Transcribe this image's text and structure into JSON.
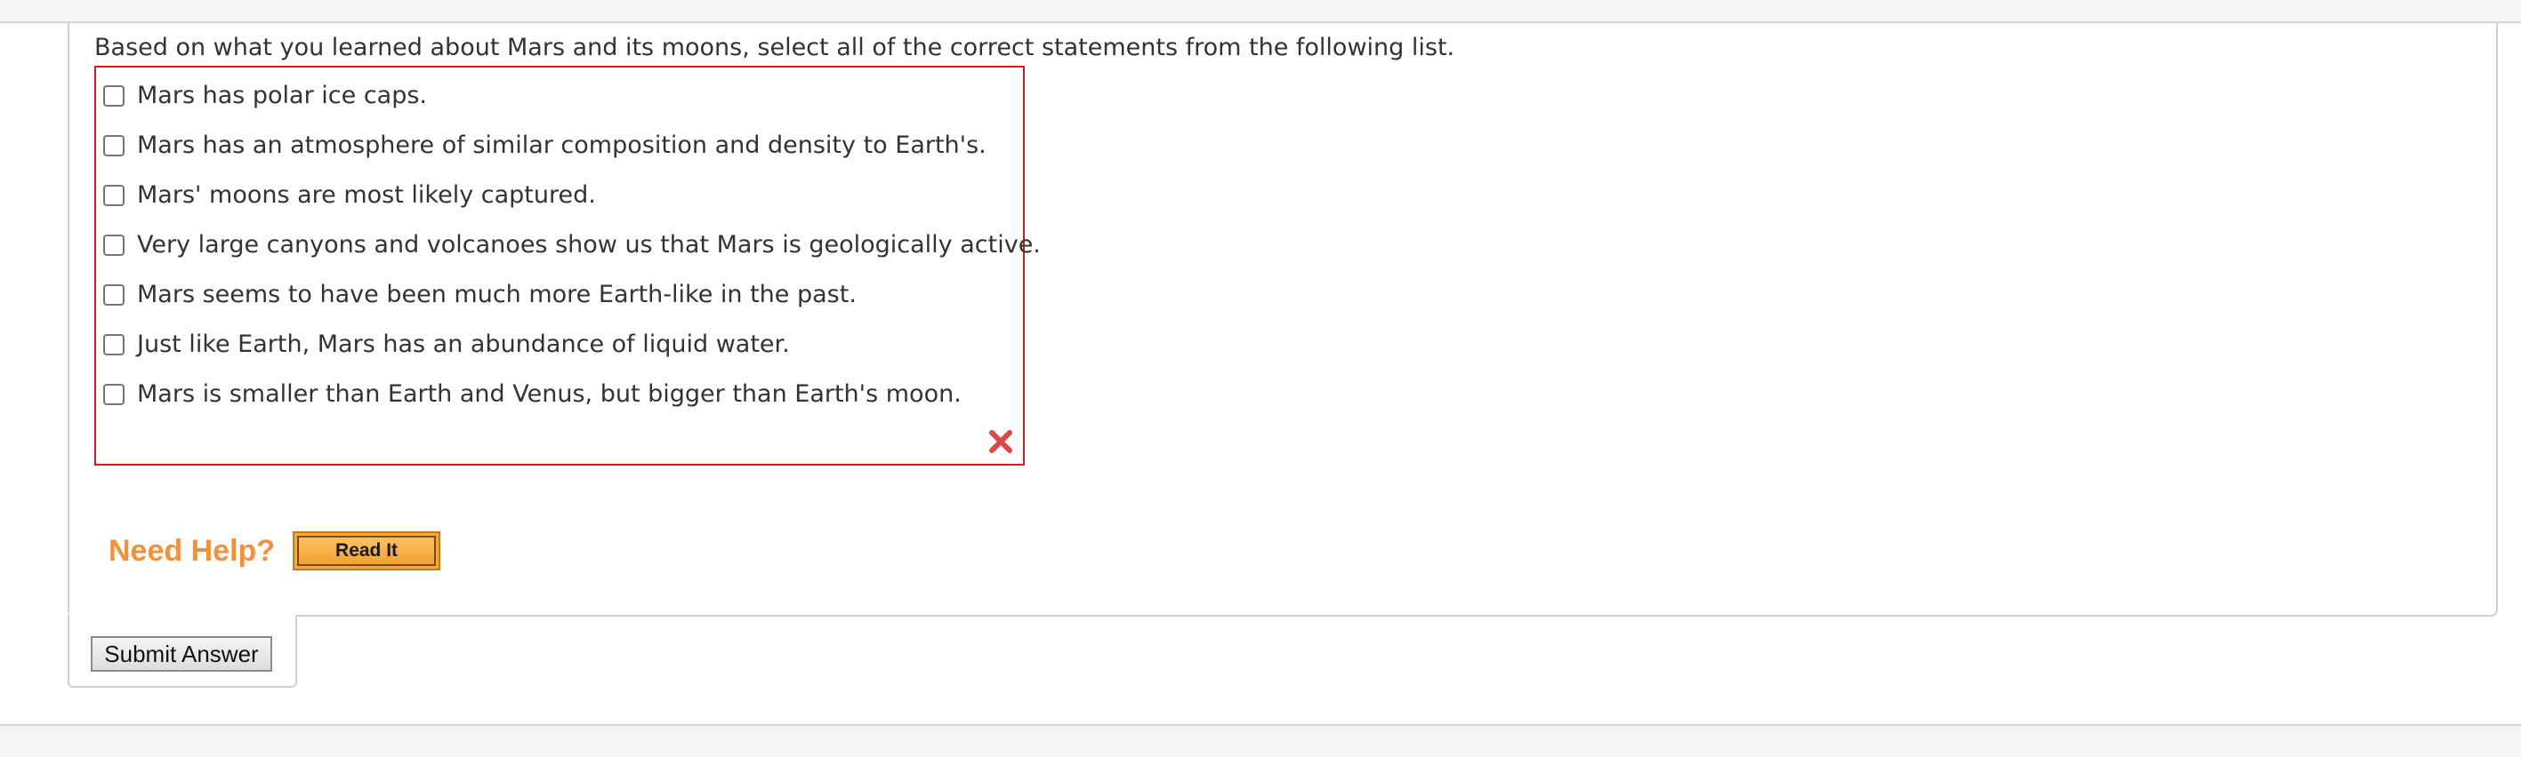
{
  "question": {
    "prompt": "Based on what you learned about Mars and its moons, select all of the correct statements from the following list.",
    "choices": [
      {
        "label": "Mars has polar ice caps.",
        "checked": false
      },
      {
        "label": "Mars has an atmosphere of similar composition and density to Earth's.",
        "checked": false
      },
      {
        "label": "Mars' moons are most likely captured.",
        "checked": false
      },
      {
        "label": "Very large canyons and volcanoes show us that Mars is geologically active.",
        "checked": false
      },
      {
        "label": "Mars seems to have been much more Earth-like in the past.",
        "checked": false
      },
      {
        "label": "Just like Earth, Mars has an abundance of liquid water.",
        "checked": false
      },
      {
        "label": "Mars is smaller than Earth and Venus, but bigger than Earth's moon.",
        "checked": false
      }
    ],
    "result_icon": "incorrect-x-icon",
    "border_color": "#d71920"
  },
  "help": {
    "label": "Need Help?",
    "read_it_label": "Read It",
    "accent_color": "#f0923b"
  },
  "actions": {
    "submit_label": "Submit Answer"
  }
}
